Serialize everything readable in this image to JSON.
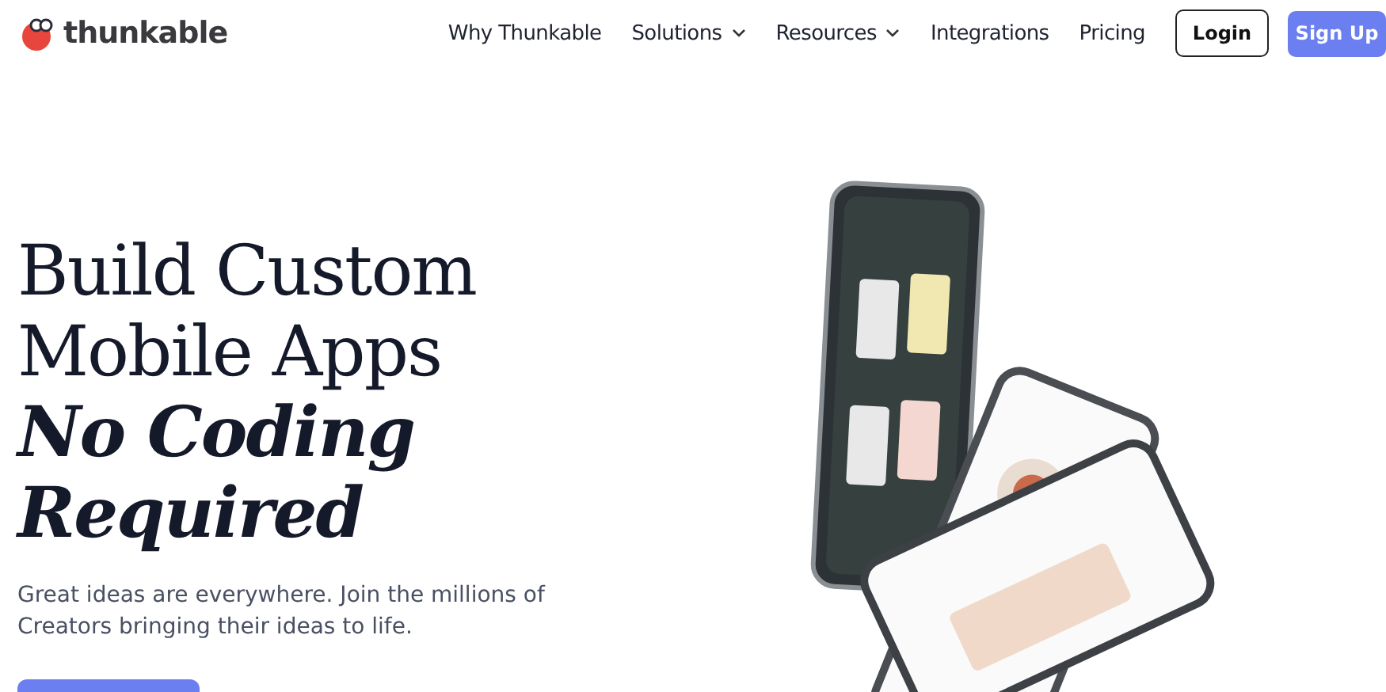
{
  "header": {
    "logo_text": "thunkable",
    "nav": [
      {
        "label": "Why Thunkable",
        "kind": "link"
      },
      {
        "label": "Solutions",
        "kind": "dropdown"
      },
      {
        "label": "Resources",
        "kind": "dropdown"
      },
      {
        "label": "Integrations",
        "kind": "link"
      },
      {
        "label": "Pricing",
        "kind": "link"
      }
    ],
    "login": "Login",
    "signup": "Sign Up"
  },
  "hero": {
    "headline": [
      {
        "text": "Build Custom",
        "kind": "plain"
      },
      {
        "text": "Mobile Apps",
        "kind": "plain"
      },
      {
        "text": "No Coding",
        "kind": "emphasis"
      },
      {
        "text": "Required",
        "kind": "emphasis"
      }
    ],
    "subtitle": "Great ideas are everywhere. Join the millions of Creators bringing their ideas to life."
  }
}
